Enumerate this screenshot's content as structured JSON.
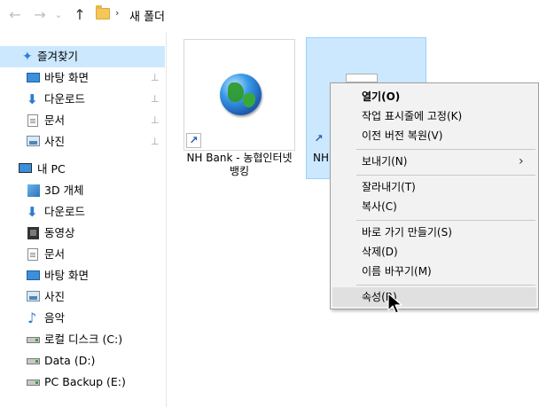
{
  "address": {
    "back_icon": "←",
    "forward_icon": "→",
    "dropdown_icon": "⌄",
    "up_icon": "↑",
    "separator": "›",
    "crumb": "새 폴더"
  },
  "sidebar": {
    "items": [
      {
        "label": "즐겨찾기",
        "icon": "star-icon",
        "glyph": "✦"
      },
      {
        "label": "바탕 화면",
        "icon": "desktop-icon",
        "glyph": ""
      },
      {
        "label": "다운로드",
        "icon": "download-icon",
        "glyph": "⬇"
      },
      {
        "label": "문서",
        "icon": "document-icon",
        "glyph": ""
      },
      {
        "label": "사진",
        "icon": "pictures-icon",
        "glyph": ""
      },
      {
        "label": "내 PC",
        "icon": "pc-icon",
        "glyph": ""
      },
      {
        "label": "3D 개체",
        "icon": "3d-objects-icon",
        "glyph": ""
      },
      {
        "label": "다운로드",
        "icon": "download-icon",
        "glyph": "⬇"
      },
      {
        "label": "동영상",
        "icon": "video-icon",
        "glyph": ""
      },
      {
        "label": "문서",
        "icon": "document-icon",
        "glyph": ""
      },
      {
        "label": "바탕 화면",
        "icon": "desktop-icon",
        "glyph": ""
      },
      {
        "label": "사진",
        "icon": "pictures-icon",
        "glyph": ""
      },
      {
        "label": "음악",
        "icon": "music-icon",
        "glyph": "♪"
      },
      {
        "label": "로컬 디스크 (C:)",
        "icon": "disk-icon",
        "glyph": ""
      },
      {
        "label": "Data (D:)",
        "icon": "disk-icon",
        "glyph": ""
      },
      {
        "label": "PC Backup (E:)",
        "icon": "disk-icon",
        "glyph": ""
      }
    ],
    "pin_glyph": "📌"
  },
  "files": [
    {
      "label": "NH Bank - 농협인터넷뱅킹",
      "icon": "globe-icon",
      "shortcut_glyph": "↗"
    },
    {
      "label": "NH",
      "icon": "shortcut-icon",
      "shortcut_glyph": "↗"
    }
  ],
  "context_menu": {
    "items": [
      {
        "label": "열기(O)",
        "bold": true
      },
      {
        "label": "작업 표시줄에 고정(K)"
      },
      {
        "label": "이전 버전 복원(V)"
      },
      {
        "label": "보내기(N)",
        "submenu": true
      },
      {
        "label": "잘라내기(T)"
      },
      {
        "label": "복사(C)"
      },
      {
        "label": "바로 가기 만들기(S)"
      },
      {
        "label": "삭제(D)"
      },
      {
        "label": "이름 바꾸기(M)"
      },
      {
        "label": "속성(R)",
        "hover": true
      }
    ],
    "submenu_arrow": "›"
  },
  "colors": {
    "selection": "#cce8ff",
    "menu_bg": "#f2f2f2",
    "menu_hover": "#e0e0e0"
  }
}
